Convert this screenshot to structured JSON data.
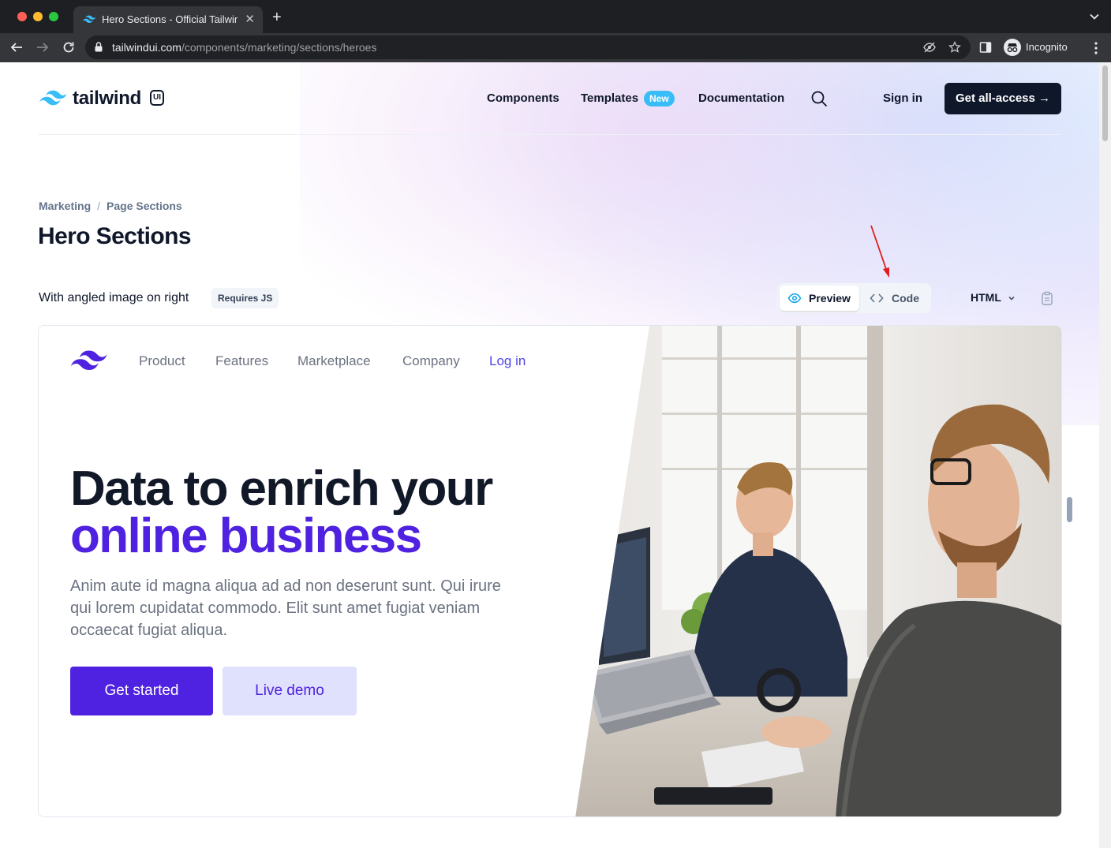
{
  "browser": {
    "tab_title": "Hero Sections - Official Tailwind UI Components",
    "url_host": "tailwindui.com",
    "url_path": "/components/marketing/sections/heroes",
    "profile_label": "Incognito"
  },
  "site": {
    "logo_text": "tailwind",
    "logo_badge": "UI",
    "nav": {
      "components": "Components",
      "templates": "Templates",
      "templates_badge": "New",
      "documentation": "Documentation",
      "sign_in": "Sign in",
      "cta": "Get all-access →"
    }
  },
  "breadcrumb": {
    "items": [
      "Marketing",
      "Page Sections"
    ],
    "separator": "/"
  },
  "page_title": "Hero Sections",
  "variant": {
    "title": "With angled image on right",
    "badge": "Requires JS",
    "tabs": {
      "preview": "Preview",
      "code": "Code"
    },
    "language": "HTML"
  },
  "preview": {
    "nav": [
      "Product",
      "Features",
      "Marketplace",
      "Company"
    ],
    "login": "Log in",
    "headline_line1": "Data to enrich your",
    "headline_line2": "online business",
    "description": "Anim aute id magna aliqua ad ad non deserunt sunt. Qui irure qui lorem cupidatat commodo. Elit sunt amet fugiat veniam occaecat fugiat aliqua.",
    "primary_button": "Get started",
    "secondary_button": "Live demo"
  },
  "colors": {
    "accent": "#4f21e0",
    "accent_light": "#e0e1fc",
    "brand_sky": "#38bdf8",
    "dark": "#0f172a",
    "annotation_arrow": "#e11d1d"
  }
}
